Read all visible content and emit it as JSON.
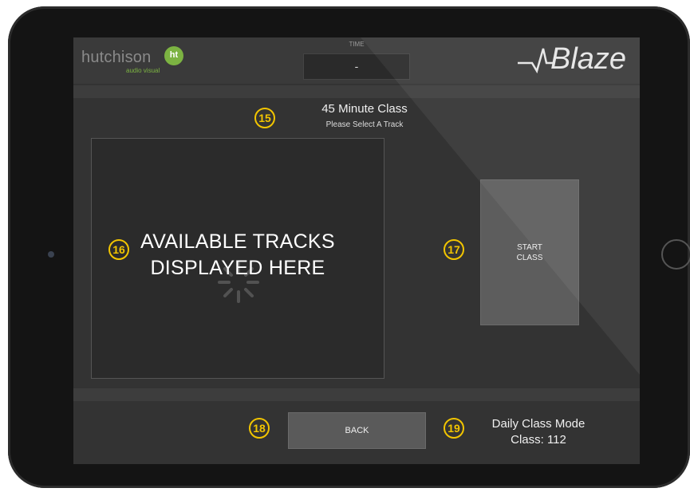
{
  "header": {
    "brand_name": "hutchison",
    "brand_sub": "audio visual",
    "brand_mark": "ht",
    "time_label": "TIME",
    "time_value": "-",
    "product_logo": "Blaze"
  },
  "class": {
    "title": "45 Minute Class",
    "subtitle": "Please Select A Track"
  },
  "tracks_panel": {
    "line1": "AVAILABLE TRACKS",
    "line2": "DISPLAYED HERE"
  },
  "start_button": {
    "line1": "START",
    "line2": "CLASS"
  },
  "back_button": {
    "label": "BACK"
  },
  "mode": {
    "line1": "Daily Class Mode",
    "line2": "Class: 112"
  },
  "callouts": [
    "15",
    "16",
    "17",
    "18",
    "19"
  ],
  "colors": {
    "callout": "#f2c500",
    "brand_green": "#7cb342",
    "screen_bg": "#333333"
  }
}
